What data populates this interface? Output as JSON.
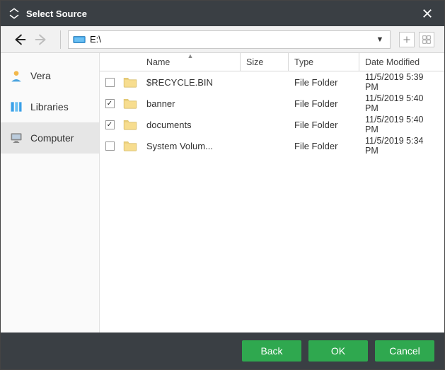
{
  "title": "Select Source",
  "path": "E:\\",
  "sidebar": {
    "items": [
      {
        "label": "Vera"
      },
      {
        "label": "Libraries"
      },
      {
        "label": "Computer"
      }
    ],
    "active_index": 2
  },
  "columns": {
    "name": "Name",
    "size": "Size",
    "type": "Type",
    "date": "Date Modified"
  },
  "rows": [
    {
      "checked": false,
      "name": "$RECYCLE.BIN",
      "size": "",
      "type": "File Folder",
      "date": "11/5/2019 5:39 PM"
    },
    {
      "checked": true,
      "name": "banner",
      "size": "",
      "type": "File Folder",
      "date": "11/5/2019 5:40 PM"
    },
    {
      "checked": true,
      "name": "documents",
      "size": "",
      "type": "File Folder",
      "date": "11/5/2019 5:40 PM"
    },
    {
      "checked": false,
      "name": "System Volum...",
      "size": "",
      "type": "File Folder",
      "date": "11/5/2019 5:34 PM"
    }
  ],
  "buttons": {
    "back": "Back",
    "ok": "OK",
    "cancel": "Cancel"
  }
}
